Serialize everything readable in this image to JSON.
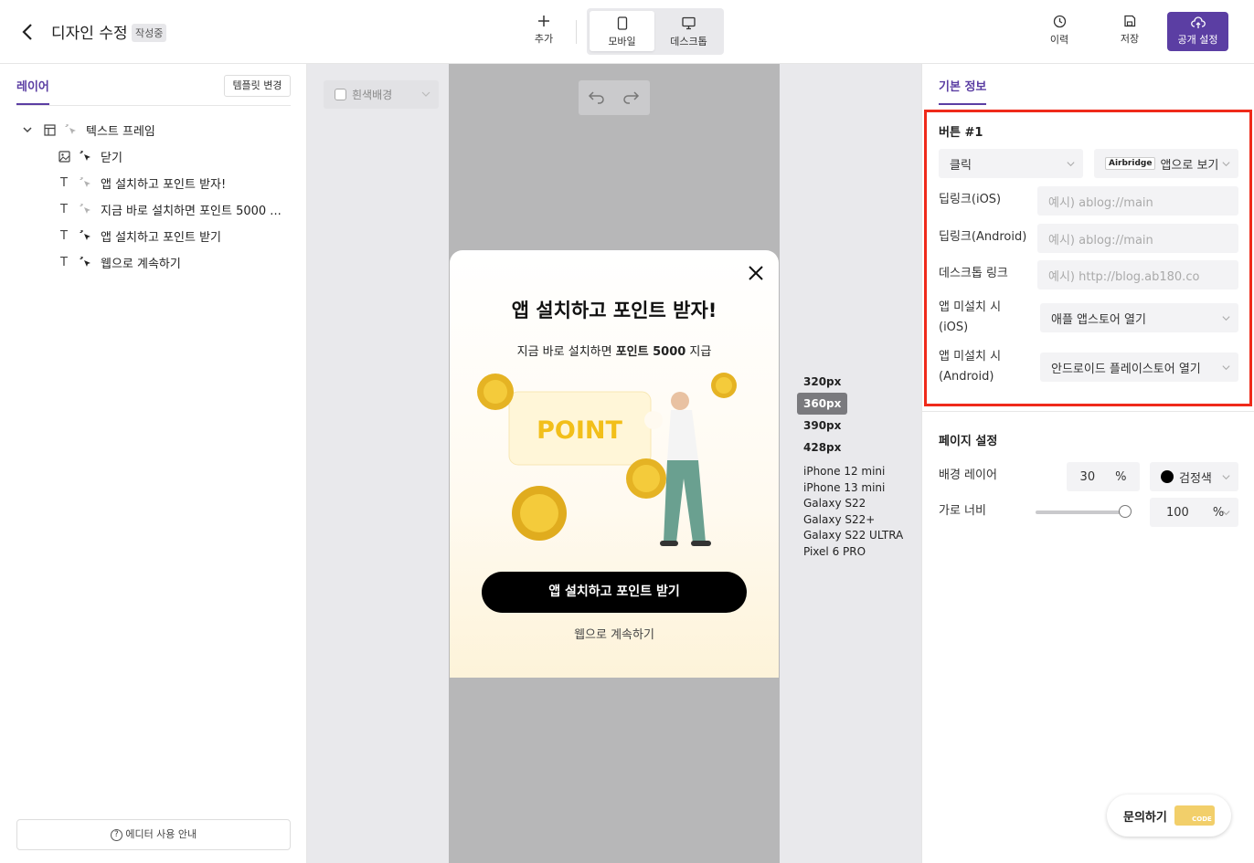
{
  "header": {
    "title": "디자인 수정",
    "status_badge": "작성중",
    "add_label": "추가",
    "mobile_label": "모바일",
    "desktop_label": "데스크톱",
    "history_label": "이력",
    "save_label": "저장",
    "publish_label": "공개 설정"
  },
  "left_panel": {
    "tab_label": "레이어",
    "template_button": "템플릿 변경",
    "layers": [
      {
        "label": "텍스트 프레임",
        "icon": "frame-icon"
      },
      {
        "label": "닫기",
        "icon": "image-icon"
      },
      {
        "label": "앱 설치하고 포인트 받자!",
        "icon": "text-icon"
      },
      {
        "label": "지금 바로 설치하면 포인트 5000 ...",
        "icon": "text-icon"
      },
      {
        "label": "앱 설치하고 포인트 받기",
        "icon": "text-icon"
      },
      {
        "label": "웹으로 계속하기",
        "icon": "text-icon"
      }
    ],
    "guide_button": "에디터 사용 안내"
  },
  "canvas": {
    "white_bg_label": "흰색배경",
    "popup": {
      "title": "앱 설치하고 포인트 받자!",
      "subtitle_prefix": "지금 바로 설치하면 ",
      "subtitle_bold": "포인트 5000",
      "subtitle_suffix": " 지급",
      "art_word": "POINT",
      "cta": "앱 설치하고 포인트 받기",
      "secondary": "웹으로 계속하기"
    },
    "sizes": [
      "320px",
      "360px",
      "390px",
      "428px"
    ],
    "active_size": "360px",
    "devices": [
      "iPhone 12 mini",
      "iPhone 13 mini",
      "Galaxy S22",
      "Galaxy S22+",
      "Galaxy S22 ULTRA",
      "Pixel 6 PRO"
    ]
  },
  "right_panel": {
    "tab_label": "기본 정보",
    "button_section": {
      "title": "버튼 #1",
      "action": "클릭",
      "airbridge_badge": "Airbridge",
      "target": "앱으로 보기",
      "ios_deeplink_label": "딥링크(iOS)",
      "ios_deeplink_placeholder": "예시) ablog://main",
      "android_deeplink_label": "딥링크(Android)",
      "android_deeplink_placeholder": "예시) ablog://main",
      "desktop_link_label": "데스크톱 링크",
      "desktop_link_placeholder": "예시) http://blog.ab180.co",
      "ios_not_installed_label_1": "앱 미설치 시",
      "ios_not_installed_label_2": "(iOS)",
      "ios_not_installed_value": "애플 앱스토어 열기",
      "android_not_installed_label_1": "앱 미설치 시",
      "android_not_installed_label_2": "(Android)",
      "android_not_installed_value": "안드로이드 플레이스토어 열기"
    },
    "page_section": {
      "title": "페이지 설정",
      "bg_layer_label": "배경 레이어",
      "bg_opacity": "30",
      "bg_opacity_unit": "%",
      "bg_color_name": "검정색",
      "width_label": "가로 너비",
      "width_value": "100",
      "width_unit": "%",
      "width_slider_fraction": 1.0
    },
    "inquiry_button": "문의하기",
    "inquiry_badge": "CODE"
  },
  "colors": {
    "accent": "#5b3ea3",
    "highlight_border": "#ef2a1a",
    "cta": "#000000"
  }
}
